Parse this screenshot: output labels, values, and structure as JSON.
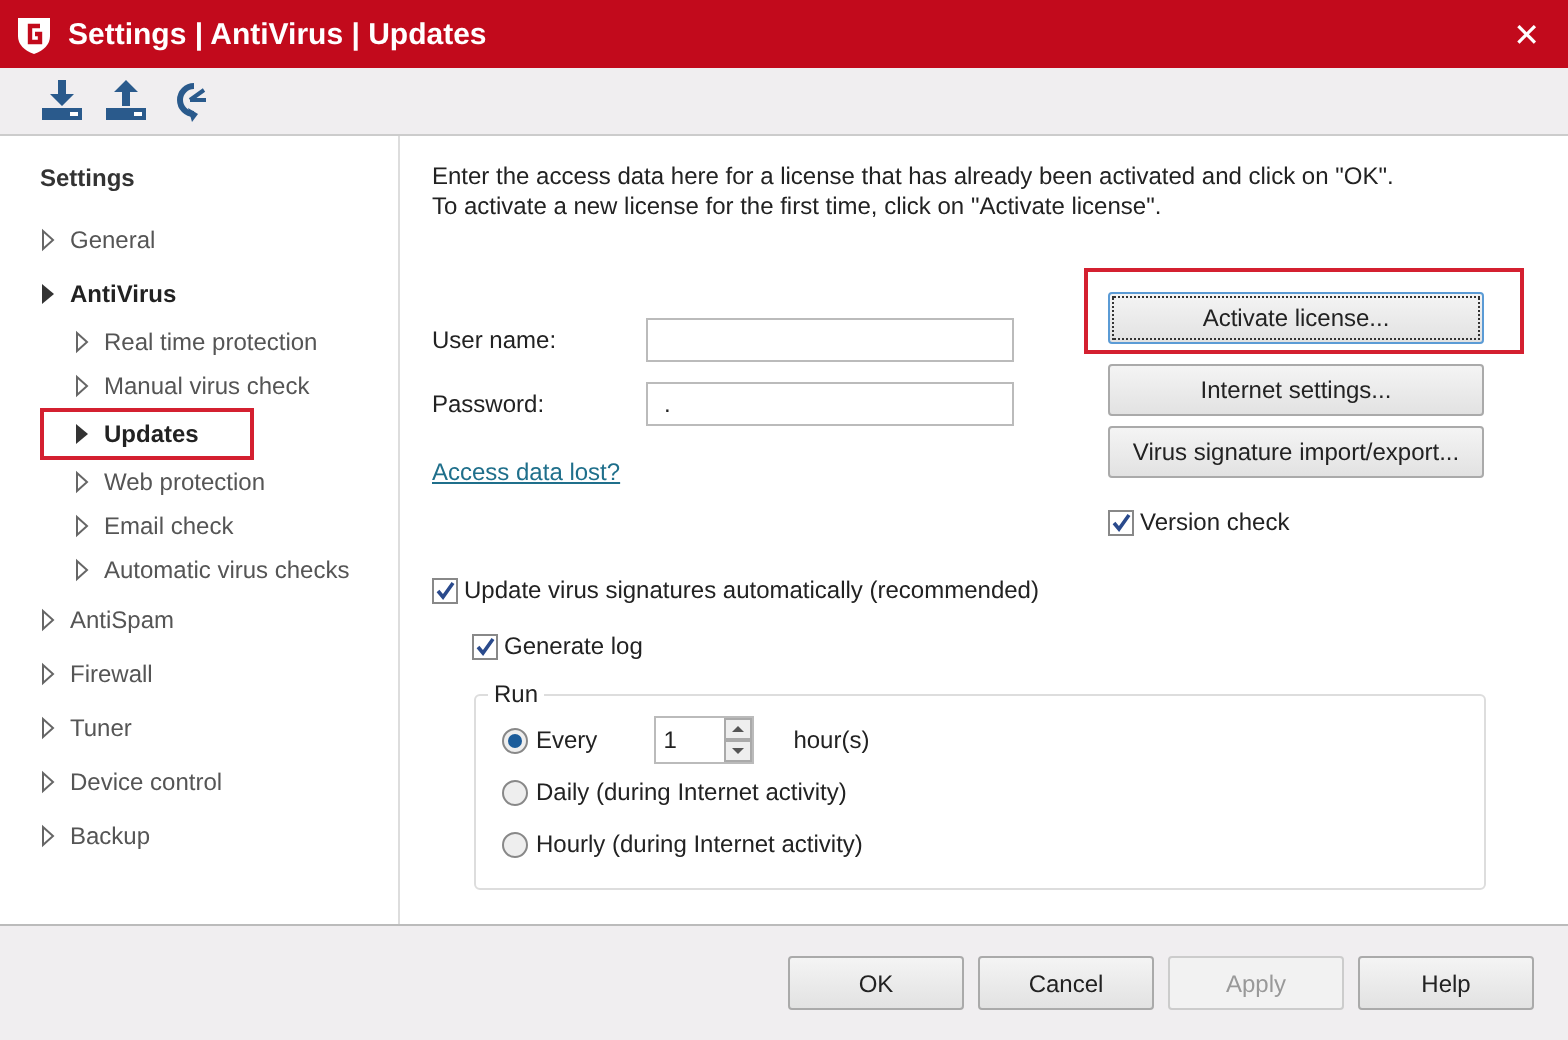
{
  "window": {
    "title": "Settings | AntiVirus | Updates",
    "close": "✕"
  },
  "toolbar": [
    {
      "kind": "download"
    },
    {
      "kind": "upload"
    },
    {
      "kind": "refresh"
    }
  ],
  "sidebar": {
    "heading": "Settings",
    "items": [
      {
        "label": "General",
        "expanded": false
      },
      {
        "label": "AntiVirus",
        "expanded": true,
        "children": [
          {
            "label": "Real time protection",
            "selected": false,
            "highlighted": false
          },
          {
            "label": "Manual virus check",
            "selected": false,
            "highlighted": false
          },
          {
            "label": "Updates",
            "selected": true,
            "highlighted": true
          },
          {
            "label": "Web protection",
            "selected": false,
            "highlighted": false
          },
          {
            "label": "Email check",
            "selected": false,
            "highlighted": false
          },
          {
            "label": "Automatic virus checks",
            "selected": false,
            "highlighted": false
          }
        ]
      },
      {
        "label": "AntiSpam",
        "expanded": false
      },
      {
        "label": "Firewall",
        "expanded": false
      },
      {
        "label": "Tuner",
        "expanded": false
      },
      {
        "label": "Device control",
        "expanded": false
      },
      {
        "label": "Backup",
        "expanded": false
      }
    ]
  },
  "intro": [
    "Enter the access data here for a license that has already been activated and click on \"OK\".",
    "To activate a new license for the first time, click on \"Activate license\"."
  ],
  "fields": [
    {
      "label": "User name:"
    },
    {
      "label": "Password:",
      "value": "."
    }
  ],
  "link": "Access data lost?",
  "side_buttons": [
    {
      "label": "Activate license...",
      "focused": true,
      "highlighted": true
    },
    {
      "label": "Internet settings...",
      "focused": false,
      "highlighted": false
    },
    {
      "label": "Virus signature import/export...",
      "focused": false,
      "highlighted": false
    }
  ],
  "version_check": {
    "label": "Version check",
    "checked": true
  },
  "auto_update": {
    "label": "Update virus signatures automatically (recommended)",
    "checked": true
  },
  "generate_log": {
    "label": "Generate log",
    "checked": true
  },
  "run": {
    "title": "Run",
    "options": [
      {
        "kind": "interval",
        "label": "Every",
        "selected": true,
        "spinner": "1",
        "unit": "hour(s)"
      },
      {
        "kind": "plain",
        "label": "Daily (during Internet activity)",
        "selected": false
      },
      {
        "kind": "plain",
        "label": "Hourly (during Internet activity)",
        "selected": false
      }
    ]
  },
  "footer": [
    {
      "label": "OK",
      "disabled": false
    },
    {
      "label": "Cancel",
      "disabled": false
    },
    {
      "label": "Apply",
      "disabled": true
    },
    {
      "label": "Help",
      "disabled": false
    }
  ]
}
